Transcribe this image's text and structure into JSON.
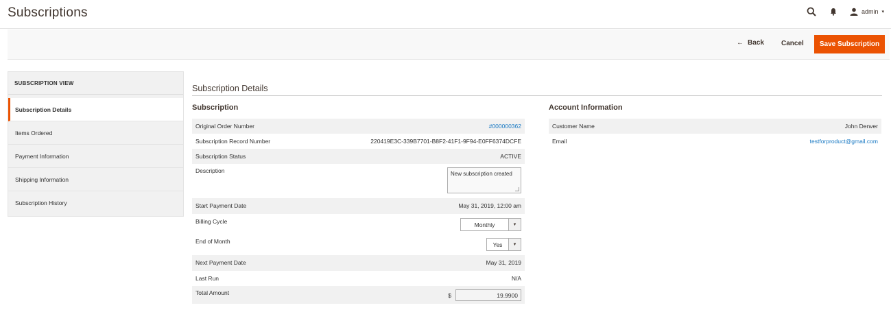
{
  "header": {
    "title": "Subscriptions",
    "search_icon": "search-icon",
    "bell_icon": "bell-icon",
    "user_icon": "user-icon",
    "user_name": "admin",
    "user_caret": "▾"
  },
  "action_bar": {
    "back_arrow": "←",
    "back_label": "Back",
    "cancel_label": "Cancel",
    "save_label": "Save Subscription",
    "save_color": "#eb5202"
  },
  "sidebar": {
    "title": "SUBSCRIPTION VIEW",
    "items": [
      {
        "label": "Subscription Details",
        "active": true
      },
      {
        "label": "Items Ordered"
      },
      {
        "label": "Payment Information"
      },
      {
        "label": "Shipping Information"
      },
      {
        "label": "Subscription History"
      }
    ]
  },
  "main": {
    "section_title": "Subscription Details",
    "subscription": {
      "title": "Subscription",
      "rows": [
        {
          "label": "Original Order Number",
          "value": "#000000362"
        },
        {
          "label": "Subscription Record Number",
          "value": "220419E3C-339B7701-B8F2-41F1-9F94-E0FF6374DCFE"
        },
        {
          "label": "Subscription Status",
          "value": "ACTIVE"
        },
        {
          "label": "Description",
          "value": "New subscription created"
        },
        {
          "label": "Start Payment Date",
          "value": "May 31, 2019, 12:00 am"
        },
        {
          "label": "Billing Cycle",
          "value": "Monthly"
        },
        {
          "label": "End of Month",
          "value": "Yes"
        },
        {
          "label": "Next Payment Date",
          "value": "May 31, 2019"
        },
        {
          "label": "Last Run",
          "value": "N/A"
        },
        {
          "label": "Total Amount",
          "currency": "$",
          "value": "19.9900"
        }
      ]
    },
    "account": {
      "title": "Account Information",
      "rows": [
        {
          "label": "Customer Name",
          "value": "John Denver"
        },
        {
          "label": "Email",
          "value": "testforproduct@gmail.com"
        }
      ]
    }
  },
  "colors": {
    "accent": "#eb5202",
    "link": "#1979c3",
    "shade": "#f1f1f1"
  }
}
